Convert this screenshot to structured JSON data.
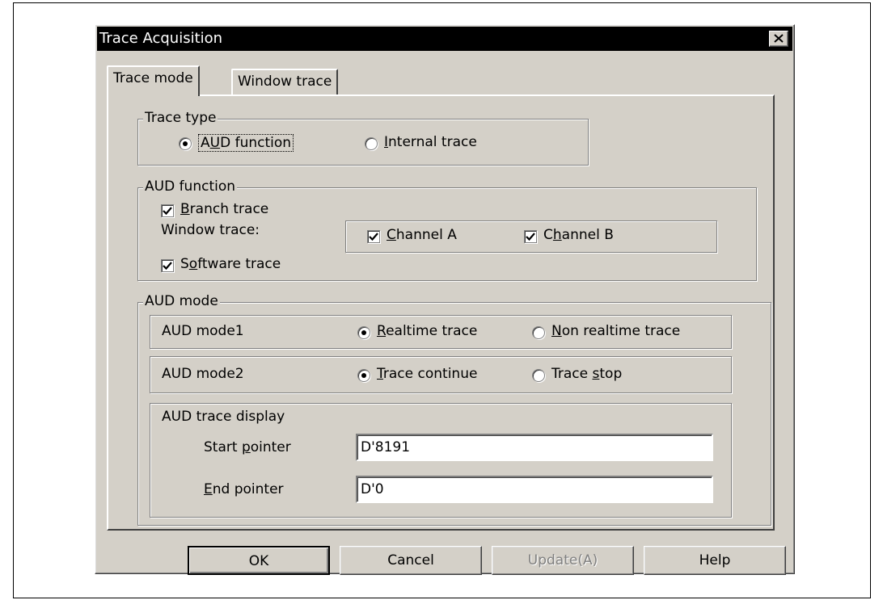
{
  "window": {
    "title": "Trace Acquisition"
  },
  "tabs": [
    {
      "label": "Trace mode",
      "active": true
    },
    {
      "label": "Window trace",
      "active": false
    }
  ],
  "trace_type": {
    "legend": "Trace type",
    "options": [
      {
        "pre": "A",
        "key": "U",
        "post": "D function",
        "selected": true
      },
      {
        "pre": "",
        "key": "I",
        "post": "nternal trace",
        "selected": false
      }
    ]
  },
  "aud_function": {
    "legend": "AUD function",
    "branch_trace": {
      "pre": "",
      "key": "B",
      "post": "ranch trace",
      "checked": true
    },
    "window_trace_label": "Window trace:",
    "channel_a": {
      "pre": "",
      "key": "C",
      "post": "hannel A",
      "checked": true
    },
    "channel_b": {
      "pre": "C",
      "key": "h",
      "post": "annel B",
      "checked": true
    },
    "software_trace": {
      "pre": "S",
      "key": "o",
      "post": "ftware trace",
      "checked": true
    }
  },
  "aud_mode": {
    "legend": "AUD mode",
    "mode1": {
      "label": "AUD mode1",
      "options": [
        {
          "pre": "",
          "key": "R",
          "post": "ealtime trace",
          "selected": true
        },
        {
          "pre": "",
          "key": "N",
          "post": "on realtime trace",
          "selected": false
        }
      ]
    },
    "mode2": {
      "label": "AUD mode2",
      "options": [
        {
          "pre": "",
          "key": "T",
          "post": "race continue",
          "selected": true
        },
        {
          "pre": "Trace ",
          "key": "s",
          "post": "top",
          "selected": false
        }
      ]
    },
    "display": {
      "label": "AUD trace display",
      "start": {
        "pre": "Start ",
        "key": "p",
        "post": "ointer",
        "value": "D'8191"
      },
      "end": {
        "pre": "",
        "key": "E",
        "post": "nd pointer",
        "value": "D'0"
      }
    }
  },
  "buttons": {
    "ok": "OK",
    "cancel": "Cancel",
    "update": "Update(A)",
    "help": "Help"
  }
}
